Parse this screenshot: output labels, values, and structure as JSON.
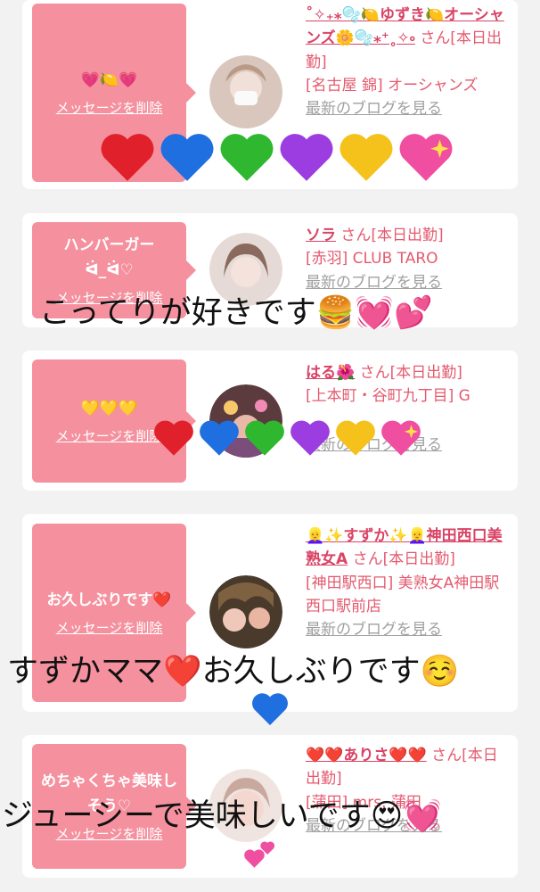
{
  "cards": [
    {
      "message": "💗🍋💗",
      "delete_label": "メッセージを削除",
      "name": "˚✧₊⁎🫧🍋ゆずき🍋オーシャンズ🌼🫧⁎⁺˳✧༚",
      "san": "さん[本日出勤]",
      "location": "[名古屋 錦] オーシャンズ",
      "blog_label": "最新のブログを見る"
    },
    {
      "message": "ハンバーガー\nᐛ_ᐛ♡",
      "delete_label": "メッセージを削除",
      "name": "ソラ",
      "san": "さん[本日出勤]",
      "location": "[赤羽] CLUB TARO",
      "blog_label": "最新のブログを見る"
    },
    {
      "message": "💛💛💛",
      "delete_label": "メッセージを削除",
      "name": "はる🌺",
      "san": "さん[本日出勤]",
      "location": "[上本町・谷町九丁目] G",
      "blog_label": "最新のブログを見る"
    },
    {
      "message": "お久しぶりです❤️",
      "delete_label": "メッセージを削除",
      "name": "👱‍♀️✨すずか✨👱‍♀️神田西口美熟女A",
      "san": "さん[本日出勤]",
      "location": "[神田駅西口] 美熟女A神田駅西口駅前店",
      "blog_label": "最新のブログを見る"
    },
    {
      "message": "めちゃくちゃ美味しそう♡",
      "delete_label": "メッセージを削除",
      "name": "❤️❤️ありさ❤️❤️",
      "san": "さん[本日出勤]",
      "location": "[蒲田] mrs. 蒲田",
      "blog_label": "最新のブログを見る"
    }
  ],
  "overlays": {
    "text1": "こってりが好きです🍔💓💕",
    "text2": "すずかママ❤️お久しぶりです☺️",
    "text3": "ジューシーで美味しいです😍💓"
  },
  "colors": {
    "bubble": "#f5919f",
    "name": "#d94466",
    "link_gray": "#a0a0a0",
    "heart_red": "#e0202a",
    "heart_blue": "#1f6fe0",
    "heart_green": "#2fb82f",
    "heart_purple": "#9b3de0",
    "heart_yellow": "#f5c21b",
    "heart_pink": "#f04ea0"
  }
}
